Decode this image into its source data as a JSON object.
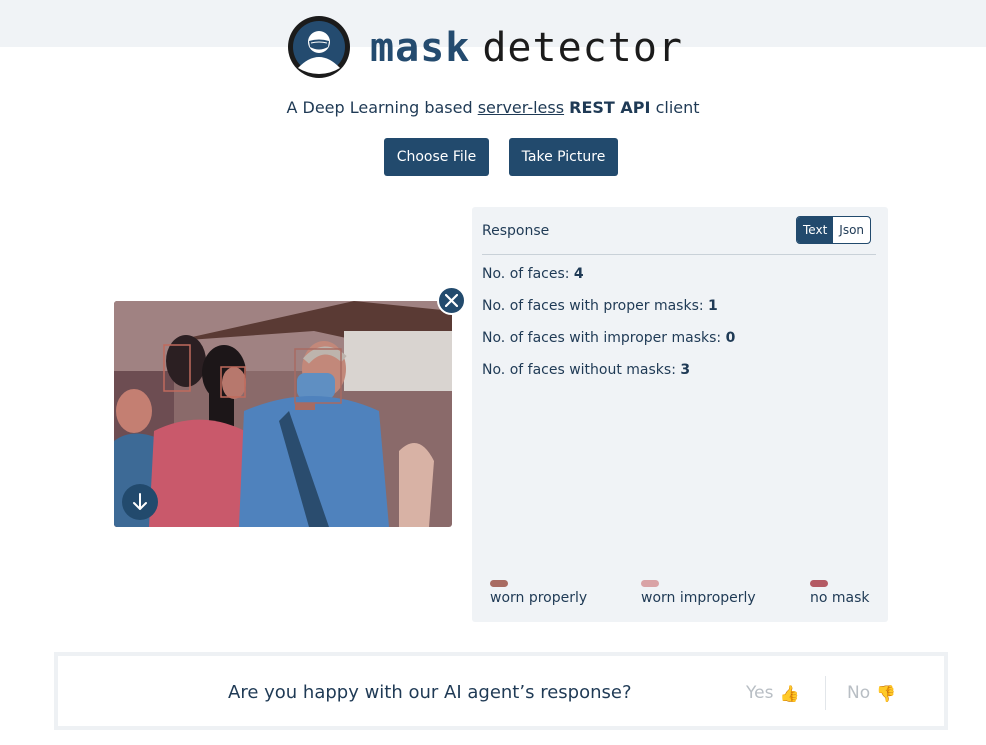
{
  "header": {
    "brand_word1": "mask",
    "brand_word2": "detector"
  },
  "tagline": {
    "prefix": "A Deep Learning based ",
    "link": "server-less",
    "middle": " ",
    "bold": "REST API",
    "suffix": " client"
  },
  "actions": {
    "choose_file": "Choose File",
    "take_picture": "Take Picture"
  },
  "preview": {
    "close_icon": "close-icon",
    "download_icon": "arrow-down-icon"
  },
  "response": {
    "title": "Response",
    "toggle": {
      "text": "Text",
      "json": "Json",
      "selected": "Text"
    },
    "stats": [
      {
        "label": "No. of faces: ",
        "value": "4"
      },
      {
        "label": "No. of faces with proper masks: ",
        "value": "1"
      },
      {
        "label": "No. of faces with improper masks: ",
        "value": "0"
      },
      {
        "label": "No. of faces without masks: ",
        "value": "3"
      }
    ],
    "legend": [
      {
        "label": "worn properly",
        "color": "#a86b62"
      },
      {
        "label": "worn improperly",
        "color": "#d9a3a6"
      },
      {
        "label": "no mask",
        "color": "#b45a64"
      }
    ]
  },
  "feedback": {
    "question": "Are you happy with our AI agent’s response?",
    "yes": "Yes",
    "yes_emoji": "👍",
    "no": "No",
    "no_emoji": "👎"
  },
  "colors": {
    "primary": "#224a6d",
    "panel_bg": "#f0f3f6",
    "text": "#1f3a55"
  }
}
